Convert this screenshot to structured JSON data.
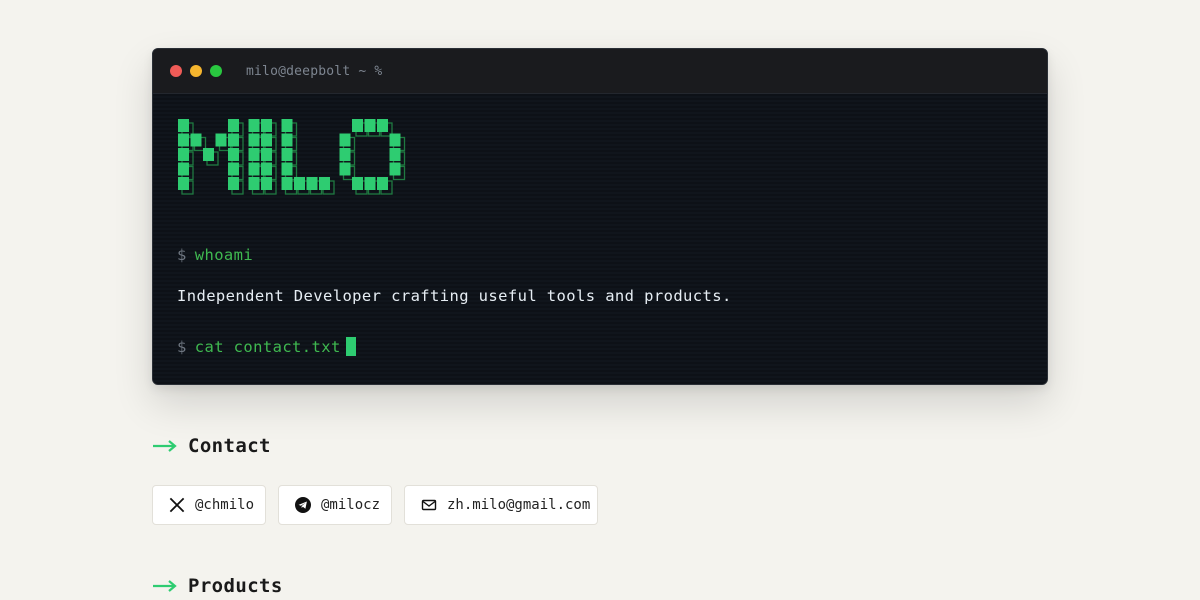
{
  "terminal": {
    "title": "milo@deepbolt ~ %",
    "logo_text": "MILO",
    "logo_color": "#2ecc71",
    "lines": [
      {
        "prompt": "$",
        "command": "whoami"
      },
      {
        "output": "Independent Developer crafting useful tools and products."
      },
      {
        "prompt": "$",
        "command": "cat contact.txt"
      }
    ]
  },
  "sections": {
    "contact": {
      "title": "Contact",
      "links": [
        {
          "icon": "x-logo-icon",
          "label": "@chmilo"
        },
        {
          "icon": "telegram-icon",
          "label": "@milocz"
        },
        {
          "icon": "mail-icon",
          "label": "zh.milo@gmail.com"
        }
      ]
    },
    "products": {
      "title": "Products"
    }
  },
  "colors": {
    "background": "#f4f3ee",
    "terminal_bg": "#0d1117",
    "accent_green": "#3fb950"
  }
}
